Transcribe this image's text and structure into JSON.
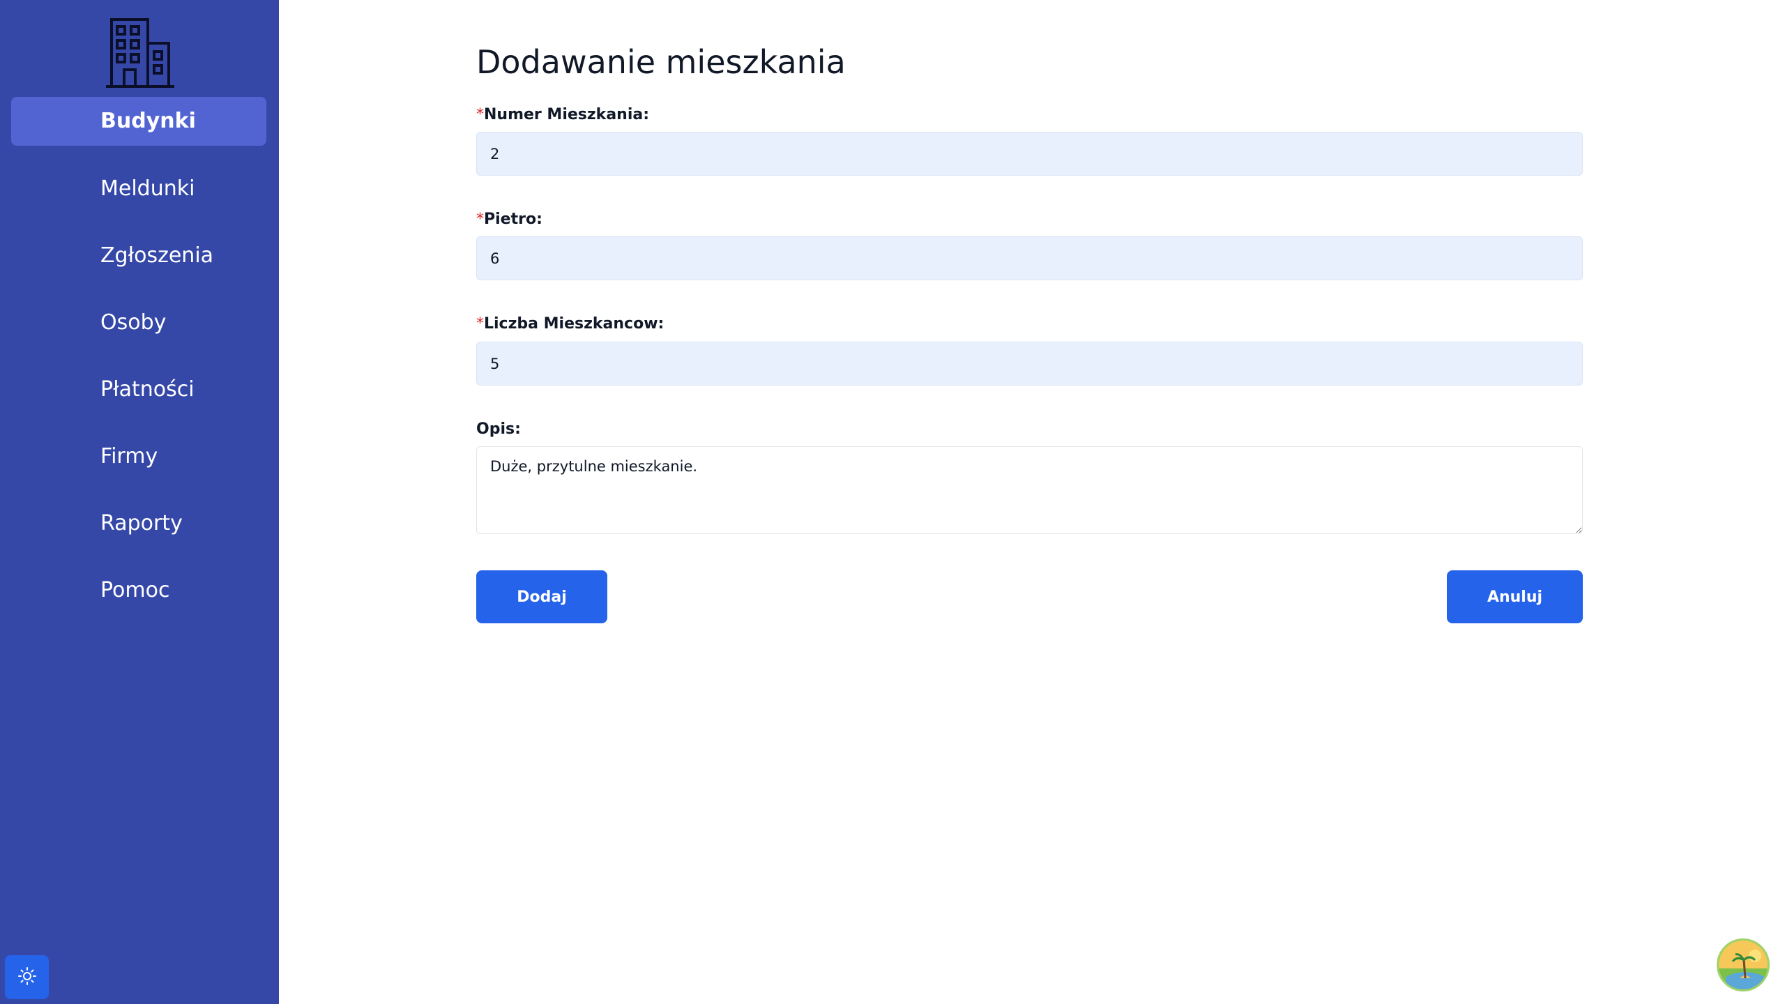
{
  "sidebar": {
    "logo_icon": "building-icon",
    "items": [
      {
        "label": "Budynki",
        "active": true
      },
      {
        "label": "Meldunki",
        "active": false
      },
      {
        "label": "Zgłoszenia",
        "active": false
      },
      {
        "label": "Osoby",
        "active": false
      },
      {
        "label": "Płatności",
        "active": false
      },
      {
        "label": "Firmy",
        "active": false
      },
      {
        "label": "Raporty",
        "active": false
      },
      {
        "label": "Pomoc",
        "active": false
      }
    ],
    "theme_toggle_icon": "sun-icon"
  },
  "form": {
    "title": "Dodawanie mieszkania",
    "required_mark": "*",
    "numer": {
      "label": "Numer Mieszkania:",
      "value": "2"
    },
    "pietro": {
      "label": "Pietro:",
      "value": "6"
    },
    "liczba": {
      "label": "Liczba Mieszkancow:",
      "value": "5"
    },
    "opis": {
      "label": "Opis:",
      "value": "Duże, przytulne mieszkanie."
    },
    "add_label": "Dodaj",
    "cancel_label": "Anuluj"
  },
  "floating_button_icon": "island-avatar-icon",
  "colors": {
    "sidebar_bg": "#3548a8",
    "sidebar_active": "#5264d1",
    "primary": "#2563eb",
    "input_bg": "#e8effd",
    "required": "#dc2626"
  }
}
